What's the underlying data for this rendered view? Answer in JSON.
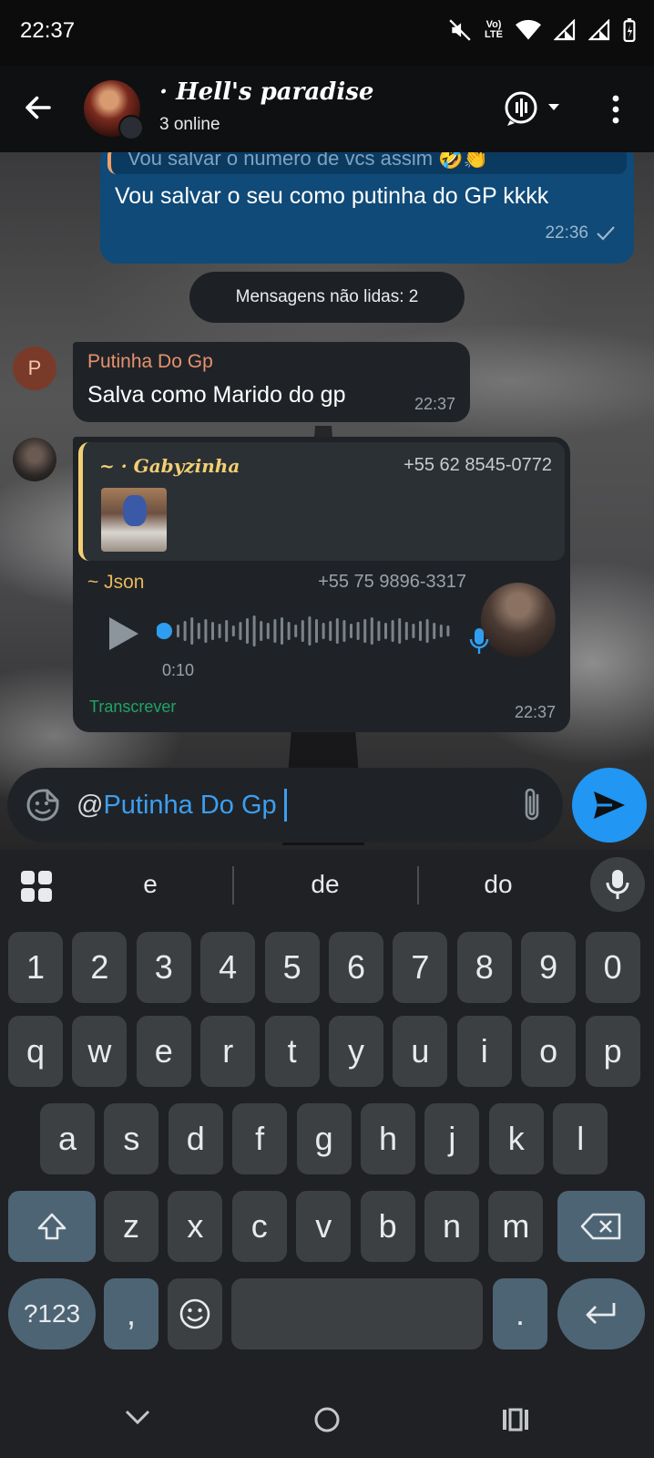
{
  "status_bar": {
    "time": "22:37",
    "network_label": "Vo) LTE"
  },
  "header": {
    "group_name": "· Hell's paradise",
    "subtitle": "3 online"
  },
  "messages": {
    "outgoing": {
      "quoted_text": "Vou salvar o numero de vcs assim 🤣👏",
      "text": "Vou salvar o seu como putinha do GP kkkk",
      "time": "22:36"
    },
    "unread_divider": "Mensagens não lidas: 2",
    "incoming_1": {
      "avatar_letter": "P",
      "sender": "Putinha Do Gp",
      "text": "Salva como Marido do gp",
      "time": "22:37"
    },
    "incoming_2": {
      "reply_name": "~ · Gabyzinha",
      "reply_phone": "+55 62 8545-0772",
      "sender": "~ Json",
      "sender_phone": "+55 75 9896-3317",
      "voice_duration": "0:10",
      "transcribe_label": "Transcrever",
      "time": "22:37"
    }
  },
  "composer": {
    "at": "@",
    "mention": "Putinha Do Gp"
  },
  "keyboard": {
    "suggestions": [
      "e",
      "de",
      "do"
    ],
    "row_numbers": [
      "1",
      "2",
      "3",
      "4",
      "5",
      "6",
      "7",
      "8",
      "9",
      "0"
    ],
    "row_1": [
      "q",
      "w",
      "e",
      "r",
      "t",
      "y",
      "u",
      "i",
      "o",
      "p"
    ],
    "row_2": [
      "a",
      "s",
      "d",
      "f",
      "g",
      "h",
      "j",
      "k",
      "l"
    ],
    "row_3": [
      "z",
      "x",
      "c",
      "v",
      "b",
      "n",
      "m"
    ],
    "symbols_key": "?123",
    "comma_key": ",",
    "period_key": "."
  },
  "colors": {
    "outgoing_bubble": "#0f4a78",
    "incoming_bubble": "#1f2327",
    "accent_blue": "#2196f3",
    "sender_orange": "#e8916e",
    "sender_gold": "#e7b75c",
    "transcribe_green": "#21a366"
  }
}
